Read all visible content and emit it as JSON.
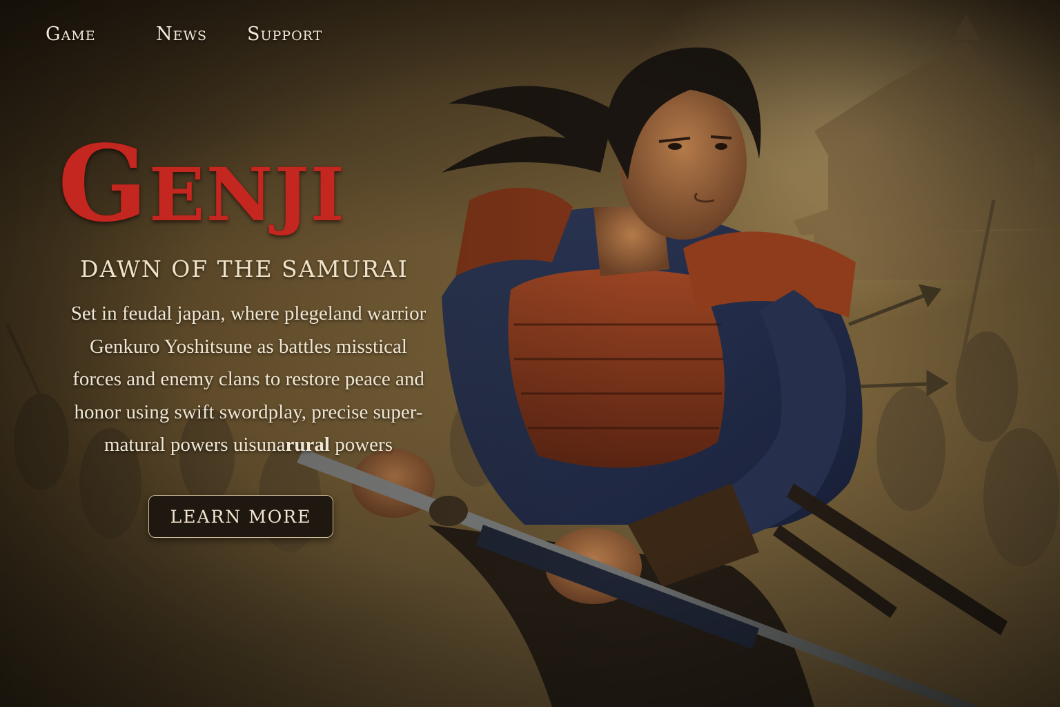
{
  "nav": {
    "items": [
      {
        "label": "Game"
      },
      {
        "label": "News"
      },
      {
        "label": "Support"
      }
    ]
  },
  "hero": {
    "title": "Genji",
    "subtitle": "DAWN OF THE SAMURAI",
    "description": {
      "line1": "Set in feudal japan, where plegeland warrior",
      "line2": "Genkuro Yoshitsune as battles misstical",
      "line3": "forces and enemy clans to restore peace and",
      "line4": "honor using swift swordplay, precise super-",
      "line5_pre": "matural powers uisuna",
      "line5_bold": "rural",
      "line5_post": " powers"
    },
    "cta_label": "LEARN MORE"
  },
  "colors": {
    "title_red": "#c3271f",
    "button_bg": "#1f1810",
    "button_border": "#cdbb97",
    "text_cream": "#efe6d3"
  },
  "illustration": {
    "subject": "samurai-warrior-with-katana",
    "background": "pagoda-castle-battlefield"
  }
}
